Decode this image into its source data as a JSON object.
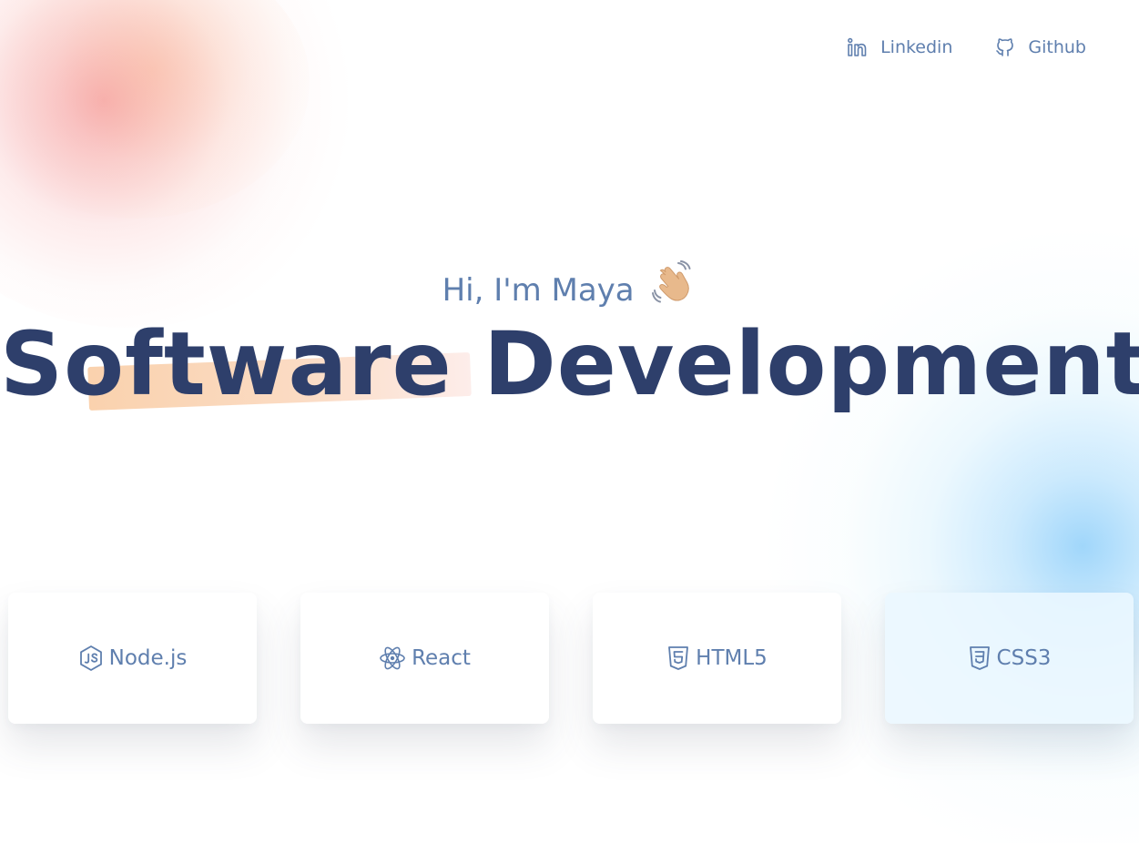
{
  "nav": {
    "linkedin_label": "Linkedin",
    "linkedin_icon": "linkedin-icon",
    "github_label": "Github",
    "github_icon": "github-icon"
  },
  "hero": {
    "greeting": "Hi, I'm Maya",
    "greeting_icon": "waving-hand-icon",
    "title_highlighted": "Software",
    "title_rest": "Development"
  },
  "skills": [
    {
      "label": "Node.js",
      "icon": "nodejs-icon"
    },
    {
      "label": "React",
      "icon": "react-icon"
    },
    {
      "label": "HTML5",
      "icon": "html5-icon"
    },
    {
      "label": "CSS3",
      "icon": "css3-icon"
    }
  ],
  "colors": {
    "accent_text": "#5f7fae",
    "headline": "#2e3f6b",
    "highlight": "#f9cda5",
    "blob_warm": "#f496a0",
    "blob_cool": "#96d2fa"
  }
}
